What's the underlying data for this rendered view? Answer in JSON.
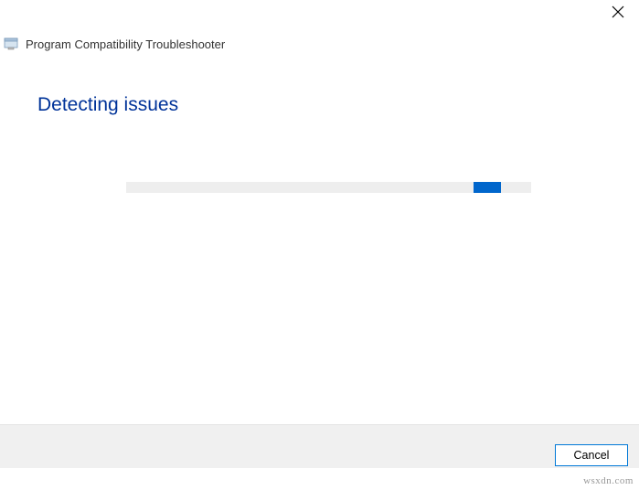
{
  "window": {
    "title": "Program Compatibility Troubleshooter"
  },
  "heading": "Detecting issues",
  "progress": {
    "indeterminate": true
  },
  "buttons": {
    "cancel": "Cancel"
  },
  "watermark": "wsxdn.com"
}
